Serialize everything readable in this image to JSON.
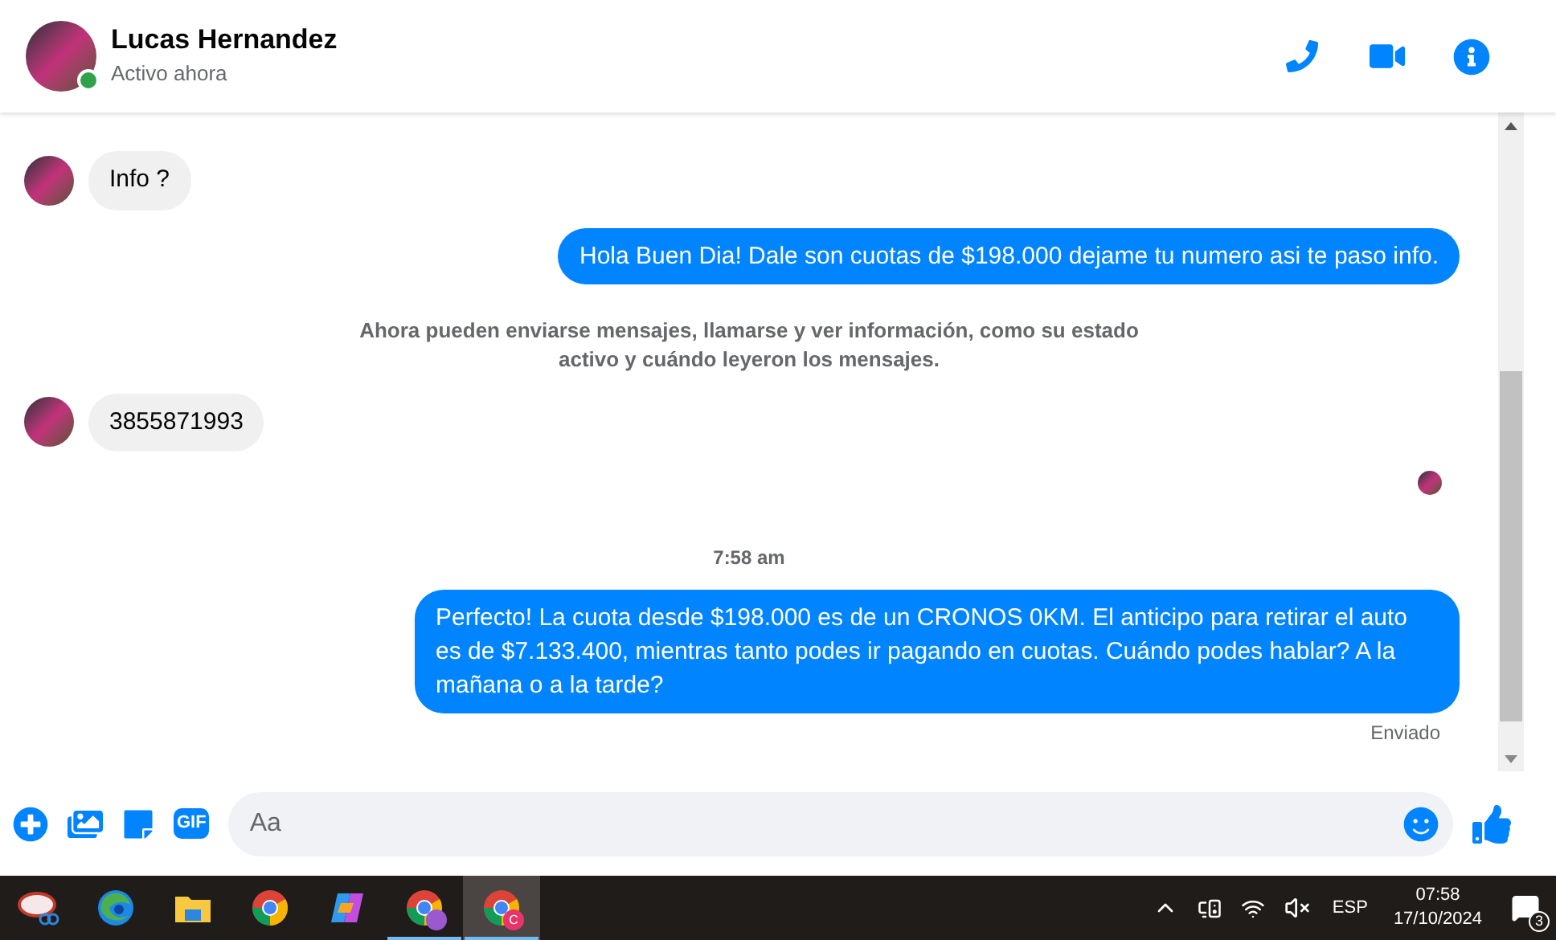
{
  "header": {
    "name": "Lucas Hernandez",
    "status": "Activo ahora",
    "online": true
  },
  "messages": [
    {
      "kind": "incoming",
      "text": "Info ?"
    },
    {
      "kind": "outgoing",
      "text": "Hola Buen Dia! Dale son cuotas de $198.000 dejame tu numero asi te paso info."
    },
    {
      "kind": "notice",
      "text": "Ahora pueden enviarse mensajes, llamarse y ver información, como su estado activo y cuándo leyeron los mensajes."
    },
    {
      "kind": "incoming",
      "text": "3855871993"
    },
    {
      "kind": "seen"
    },
    {
      "kind": "time",
      "text": "7:58 am"
    },
    {
      "kind": "outgoing",
      "text": "Perfecto! La cuota desde $198.000 es de un CRONOS 0KM. El anticipo para retirar el auto es de $7.133.400, mientras tanto podes ir pagando en cuotas. Cuándo podes hablar? A la mañana o a la tarde?"
    },
    {
      "kind": "status",
      "text": "Enviado"
    }
  ],
  "composer": {
    "placeholder": "Aa",
    "gif_label": "GIF"
  },
  "taskbar": {
    "apps": [
      {
        "kind": "snipping",
        "running": false,
        "selected": false
      },
      {
        "kind": "edge",
        "running": false,
        "selected": false
      },
      {
        "kind": "explorer",
        "running": false,
        "selected": false
      },
      {
        "kind": "chrome",
        "running": false,
        "selected": false
      },
      {
        "kind": "copilot",
        "running": false,
        "selected": false
      },
      {
        "kind": "chrome",
        "running": true,
        "selected": false,
        "badge": {
          "kind": "photo"
        }
      },
      {
        "kind": "chrome",
        "running": true,
        "selected": true,
        "badge": {
          "kind": "letter",
          "text": "C"
        }
      }
    ],
    "language": "ESP",
    "time": "07:58",
    "date": "17/10/2024",
    "notifications": "3"
  }
}
